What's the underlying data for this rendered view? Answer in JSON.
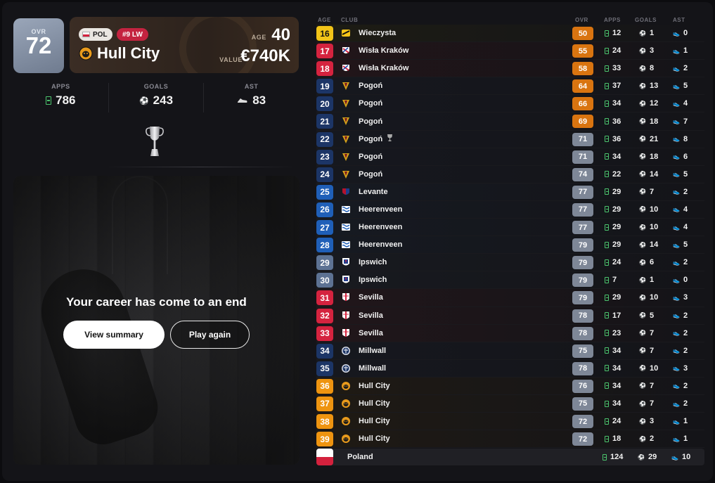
{
  "player": {
    "ovr_label": "OVR",
    "ovr": "72",
    "nationality": "POL",
    "position": "#9 LW",
    "club": "Hull City",
    "age_label": "AGE",
    "age": "40",
    "value_label": "VALUE",
    "value": "€740K"
  },
  "career_stats": [
    {
      "label": "APPS",
      "value": "786",
      "icon": "apps-icon"
    },
    {
      "label": "GOALS",
      "value": "243",
      "icon": "ball-icon"
    },
    {
      "label": "AST",
      "value": "83",
      "icon": "boot-icon"
    }
  ],
  "end_panel": {
    "title": "Your career has come to an end",
    "summary_button": "View summary",
    "again_button": "Play again"
  },
  "table_headers": {
    "age": "AGE",
    "club": "CLUB",
    "ovr": "OVR",
    "apps": "APPS",
    "goals": "GOALS",
    "ast": "AST"
  },
  "colors": {
    "age_yellow": "#f2c418",
    "age_red": "#d5233f",
    "age_navy": "#1c3566",
    "age_blue": "#1f5fb8",
    "age_slate": "#5d7293",
    "age_orange": "#ee9410",
    "ovr_orange": "#d97410",
    "ovr_gray": "#7e8797",
    "apps_green": "#4bc46d"
  },
  "seasons": [
    {
      "age": "16",
      "club": "Wieczysta",
      "ovr": "50",
      "apps": "12",
      "goals": "1",
      "ast": "0",
      "age_color": "yellow",
      "ovr_color": "orange",
      "crest": "wieczysta-crest",
      "row_tint": "#1d1c14"
    },
    {
      "age": "17",
      "club": "Wisła Kraków",
      "ovr": "55",
      "apps": "24",
      "goals": "3",
      "ast": "1",
      "age_color": "red",
      "ovr_color": "orange",
      "crest": "wisla-crest",
      "row_tint": "#221519"
    },
    {
      "age": "18",
      "club": "Wisła Kraków",
      "ovr": "58",
      "apps": "33",
      "goals": "8",
      "ast": "2",
      "age_color": "red",
      "ovr_color": "orange",
      "crest": "wisla-crest",
      "row_tint": "#221519"
    },
    {
      "age": "19",
      "club": "Pogoń",
      "ovr": "64",
      "apps": "37",
      "goals": "13",
      "ast": "5",
      "age_color": "navy",
      "ovr_color": "orange",
      "crest": "pogon-crest",
      "row_tint": "#16181f"
    },
    {
      "age": "20",
      "club": "Pogoń",
      "ovr": "66",
      "apps": "34",
      "goals": "12",
      "ast": "4",
      "age_color": "navy",
      "ovr_color": "orange",
      "crest": "pogon-crest",
      "row_tint": "#16181f"
    },
    {
      "age": "21",
      "club": "Pogoń",
      "ovr": "69",
      "apps": "36",
      "goals": "18",
      "ast": "7",
      "age_color": "navy",
      "ovr_color": "orange",
      "crest": "pogon-crest",
      "row_tint": "#16181f"
    },
    {
      "age": "22",
      "club": "Pogoń",
      "ovr": "71",
      "apps": "36",
      "goals": "21",
      "ast": "8",
      "age_color": "navy",
      "ovr_color": "gray",
      "crest": "pogon-crest",
      "row_tint": "#16181f",
      "trophy": true
    },
    {
      "age": "23",
      "club": "Pogoń",
      "ovr": "71",
      "apps": "34",
      "goals": "18",
      "ast": "6",
      "age_color": "navy",
      "ovr_color": "gray",
      "crest": "pogon-crest",
      "row_tint": "#16181f"
    },
    {
      "age": "24",
      "club": "Pogoń",
      "ovr": "74",
      "apps": "22",
      "goals": "14",
      "ast": "5",
      "age_color": "navy",
      "ovr_color": "gray",
      "crest": "pogon-crest",
      "row_tint": "#16181f"
    },
    {
      "age": "25",
      "club": "Levante",
      "ovr": "77",
      "apps": "29",
      "goals": "7",
      "ast": "2",
      "age_color": "blue",
      "ovr_color": "gray",
      "crest": "levante-crest",
      "row_tint": "#161a22"
    },
    {
      "age": "26",
      "club": "Heerenveen",
      "ovr": "77",
      "apps": "29",
      "goals": "10",
      "ast": "4",
      "age_color": "blue",
      "ovr_color": "gray",
      "crest": "heerenveen-crest",
      "row_tint": "#161a22"
    },
    {
      "age": "27",
      "club": "Heerenveen",
      "ovr": "77",
      "apps": "29",
      "goals": "10",
      "ast": "4",
      "age_color": "blue",
      "ovr_color": "gray",
      "crest": "heerenveen-crest",
      "row_tint": "#161a22"
    },
    {
      "age": "28",
      "club": "Heerenveen",
      "ovr": "79",
      "apps": "29",
      "goals": "14",
      "ast": "5",
      "age_color": "blue",
      "ovr_color": "gray",
      "crest": "heerenveen-crest",
      "row_tint": "#161a22"
    },
    {
      "age": "29",
      "club": "Ipswich",
      "ovr": "79",
      "apps": "24",
      "goals": "6",
      "ast": "2",
      "age_color": "slate",
      "ovr_color": "gray",
      "crest": "ipswich-crest",
      "row_tint": "#181a20"
    },
    {
      "age": "30",
      "club": "Ipswich",
      "ovr": "79",
      "apps": "7",
      "goals": "1",
      "ast": "0",
      "age_color": "slate",
      "ovr_color": "gray",
      "crest": "ipswich-crest",
      "row_tint": "#181a20"
    },
    {
      "age": "31",
      "club": "Sevilla",
      "ovr": "79",
      "apps": "29",
      "goals": "10",
      "ast": "3",
      "age_color": "red",
      "ovr_color": "gray",
      "crest": "sevilla-crest",
      "row_tint": "#21161a"
    },
    {
      "age": "32",
      "club": "Sevilla",
      "ovr": "78",
      "apps": "17",
      "goals": "5",
      "ast": "2",
      "age_color": "red",
      "ovr_color": "gray",
      "crest": "sevilla-crest",
      "row_tint": "#21161a"
    },
    {
      "age": "33",
      "club": "Sevilla",
      "ovr": "78",
      "apps": "23",
      "goals": "7",
      "ast": "2",
      "age_color": "red",
      "ovr_color": "gray",
      "crest": "sevilla-crest",
      "row_tint": "#21161a"
    },
    {
      "age": "34",
      "club": "Millwall",
      "ovr": "75",
      "apps": "34",
      "goals": "7",
      "ast": "2",
      "age_color": "navy",
      "ovr_color": "gray",
      "crest": "millwall-crest",
      "row_tint": "#16181f"
    },
    {
      "age": "35",
      "club": "Millwall",
      "ovr": "78",
      "apps": "34",
      "goals": "10",
      "ast": "3",
      "age_color": "navy",
      "ovr_color": "gray",
      "crest": "millwall-crest",
      "row_tint": "#16181f"
    },
    {
      "age": "36",
      "club": "Hull City",
      "ovr": "76",
      "apps": "34",
      "goals": "7",
      "ast": "2",
      "age_color": "orange",
      "ovr_color": "gray",
      "crest": "hull-crest",
      "row_tint": "#1f1a14"
    },
    {
      "age": "37",
      "club": "Hull City",
      "ovr": "75",
      "apps": "34",
      "goals": "7",
      "ast": "2",
      "age_color": "orange",
      "ovr_color": "gray",
      "crest": "hull-crest",
      "row_tint": "#1f1a14"
    },
    {
      "age": "38",
      "club": "Hull City",
      "ovr": "72",
      "apps": "24",
      "goals": "3",
      "ast": "1",
      "age_color": "orange",
      "ovr_color": "gray",
      "crest": "hull-crest",
      "row_tint": "#1f1a14"
    },
    {
      "age": "39",
      "club": "Hull City",
      "ovr": "72",
      "apps": "18",
      "goals": "2",
      "ast": "1",
      "age_color": "orange",
      "ovr_color": "gray",
      "crest": "hull-crest",
      "row_tint": "#1f1a14"
    }
  ],
  "totals": {
    "nation": "Poland",
    "apps": "124",
    "goals": "29",
    "ast": "10"
  }
}
